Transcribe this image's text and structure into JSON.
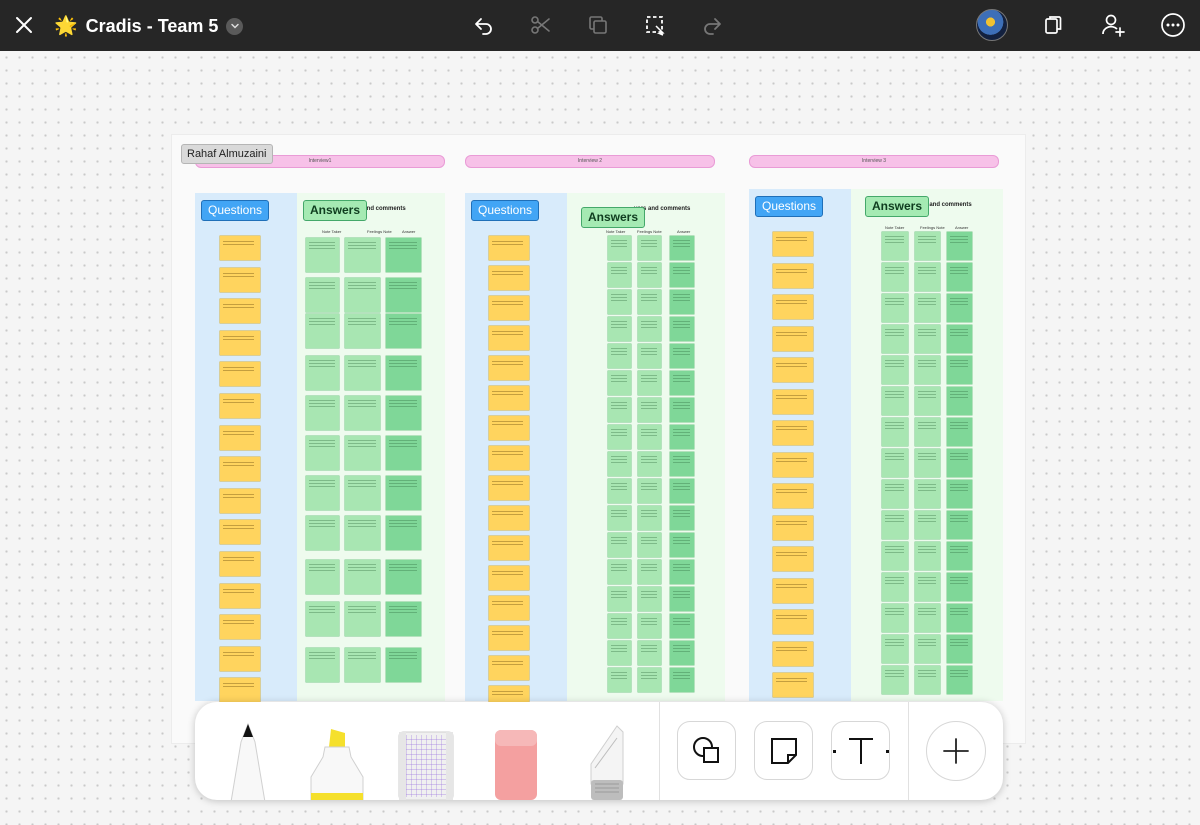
{
  "app": {
    "title": "Cradis - Team 5",
    "title_emoji": "🌟",
    "icons": {
      "close": "close-icon",
      "title_menu": "chevron-down-icon",
      "undo": "undo-icon",
      "cut": "scissors-icon",
      "duplicate": "duplicate-icon",
      "select": "lasso-select-icon",
      "redo": "redo-icon",
      "avatar": "user-avatar",
      "pages": "pages-icon",
      "add_user": "add-person-icon",
      "more": "more-icon"
    }
  },
  "board": {
    "author_tag": "Rahaf Almuzaini",
    "interviews": [
      {
        "label": "Interview1",
        "questions_tag": "Questions",
        "answers_tag": "Answers",
        "answers_header": "rs and comments",
        "sub_headers": [
          "Note Taker",
          "Feelings Note",
          "Answer"
        ]
      },
      {
        "label": "Interview 2",
        "questions_tag": "Questions",
        "answers_tag": "Answers",
        "answers_header": "vers and comments",
        "sub_headers": [
          "Note Taker",
          "Feelings Note",
          "Answer"
        ]
      },
      {
        "label": "Interview 3",
        "questions_tag": "Questions",
        "answers_tag": "Answers",
        "answers_header": "rs and comments",
        "sub_headers": [
          "Note Taker",
          "Feelings Note",
          "Answer"
        ]
      }
    ]
  },
  "toolbar": {
    "tools": [
      "pen-tool",
      "highlighter-tool",
      "grid-ruler-tool",
      "eraser-tool",
      "lasso-tool"
    ],
    "buttons": [
      "shapes-button",
      "sticky-note-button",
      "text-button",
      "add-button"
    ],
    "colors": {
      "highlighter": "#f5e02c",
      "eraser": "#f4a0a0",
      "grid": "#b69be6"
    }
  }
}
